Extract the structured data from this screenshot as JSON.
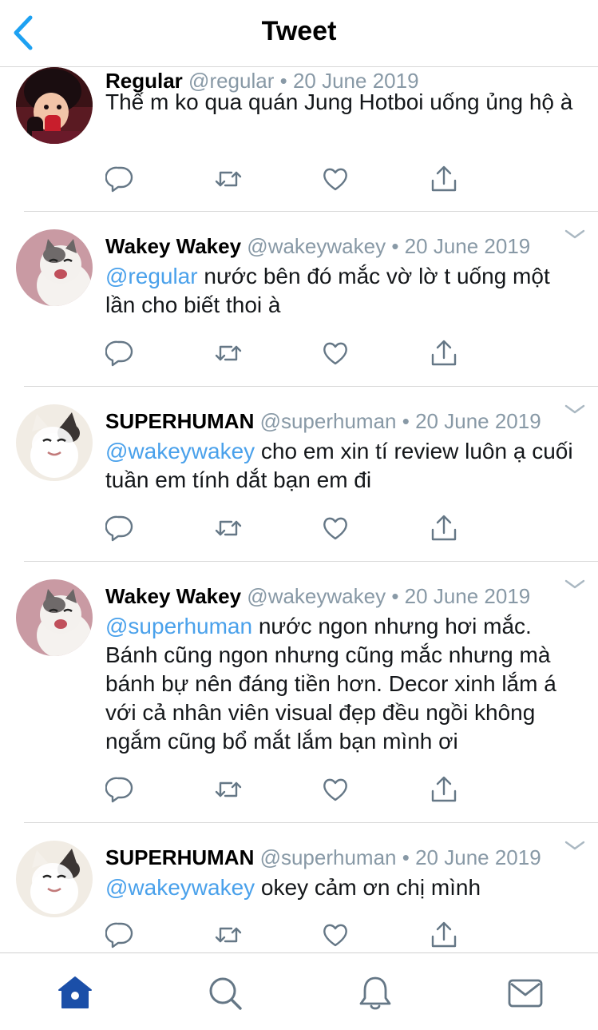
{
  "header": {
    "title": "Tweet",
    "back_icon": "chevron-left-icon"
  },
  "colors": {
    "accent": "#1da1f2",
    "mention": "#4aa1eb",
    "secondary": "#8899a6",
    "tab_active": "#1b4fa8"
  },
  "tweets": [
    {
      "name": "Regular",
      "handle": "@regular",
      "dot": "•",
      "date": "20 June 2019",
      "mention": "",
      "text": "Thế m ko qua quán Jung Hotboi uống ủng hộ à",
      "avatar": "cartoon-girl-avatar"
    },
    {
      "name": "Wakey Wakey",
      "handle": "@wakeywakey",
      "dot": "•",
      "date": "20 June 2019",
      "mention": "@regular",
      "text": " nước bên đó mắc vờ lờ t uống một lần cho biết thoi à",
      "avatar": "laughing-cat-avatar"
    },
    {
      "name": "SUPERHUMAN",
      "handle": "@superhuman",
      "dot": "•",
      "date": "20 June 2019",
      "mention": "@wakeywakey",
      "text": " cho em xin tí review luôn ạ cuối tuần em tính dắt bạn em đi",
      "avatar": "smiling-cat-avatar"
    },
    {
      "name": "Wakey Wakey",
      "handle": "@wakeywakey",
      "dot": "•",
      "date": "20 June 2019",
      "mention": "@superhuman",
      "text": " nước ngon nhưng hơi mắc. Bánh cũng ngon nhưng cũng mắc nhưng mà bánh bự nên đáng tiền hơn. Decor xinh lắm á với cả nhân viên visual đẹp đều ngồi không ngắm cũng bổ mắt lắm bạn mình ơi",
      "avatar": "laughing-cat-avatar"
    },
    {
      "name": "SUPERHUMAN",
      "handle": "@superhuman",
      "dot": "•",
      "date": "20 June 2019",
      "mention": "@wakeywakey",
      "text": " okey cảm ơn chị mình",
      "avatar": "smiling-cat-avatar"
    }
  ],
  "actions": [
    "reply-icon",
    "retweet-icon",
    "like-icon",
    "share-icon"
  ],
  "tabs": [
    {
      "icon": "home-icon",
      "active": true
    },
    {
      "icon": "search-icon",
      "active": false
    },
    {
      "icon": "notifications-bell-icon",
      "active": false
    },
    {
      "icon": "messages-envelope-icon",
      "active": false
    }
  ]
}
